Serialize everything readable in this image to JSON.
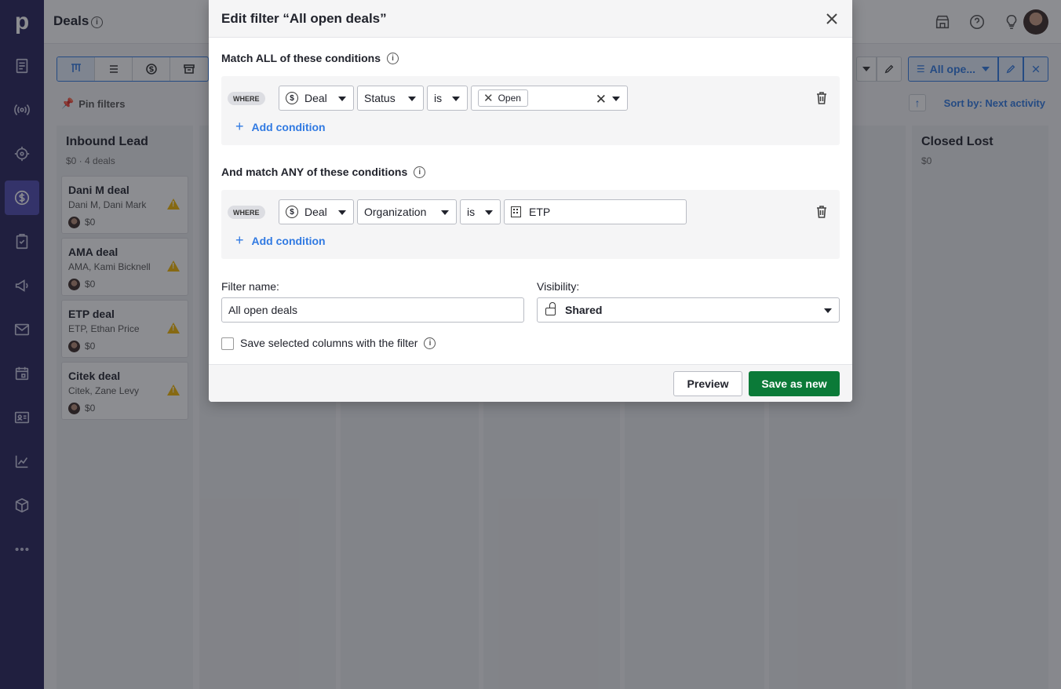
{
  "app": {
    "logo": "p"
  },
  "header": {
    "title": "Deals"
  },
  "toolbar": {
    "filter_label": "All ope...",
    "pin_filters": "Pin filters",
    "sort_label": "Sort by: Next activity"
  },
  "stages": [
    {
      "name": "Inbound Lead",
      "summary": "$0 · 4 deals"
    },
    {
      "name": "Closed Lost",
      "summary": "$0"
    }
  ],
  "deals": [
    {
      "title": "Dani M deal",
      "people": "Dani M, Dani Mark",
      "value": "$0"
    },
    {
      "title": "AMA deal",
      "people": "AMA, Kami Bicknell",
      "value": "$0"
    },
    {
      "title": "ETP deal",
      "people": "ETP, Ethan Price",
      "value": "$0"
    },
    {
      "title": "Citek deal",
      "people": "Citek, Zane Levy",
      "value": "$0"
    }
  ],
  "modal": {
    "title": "Edit filter “All open deals”",
    "all_label": "Match ALL of these conditions",
    "any_label": "And match ANY of these conditions",
    "where": "WHERE",
    "add_condition": "Add condition",
    "all_condition": {
      "entity": "Deal",
      "field": "Status",
      "operator": "is",
      "value_tag": "Open"
    },
    "any_condition": {
      "entity": "Deal",
      "field": "Organization",
      "operator": "is",
      "value": "ETP"
    },
    "filter_name_label": "Filter name:",
    "filter_name_value": "All open deals",
    "visibility_label": "Visibility:",
    "visibility_value": "Shared",
    "save_columns_label": "Save selected columns with the filter",
    "preview_button": "Preview",
    "save_button": "Save as new"
  },
  "icons": {
    "nav": [
      "leads-icon",
      "radio-icon",
      "target-icon",
      "deals-icon",
      "tasks-icon",
      "campaigns-icon",
      "mail-icon",
      "calendar-icon",
      "contacts-icon",
      "insights-icon",
      "products-icon",
      "more-icon"
    ]
  },
  "colors": {
    "nav_bg": "#26235a",
    "nav_active": "#4f4bb0",
    "accent": "#317ae2",
    "save_green": "#0b7a38"
  }
}
